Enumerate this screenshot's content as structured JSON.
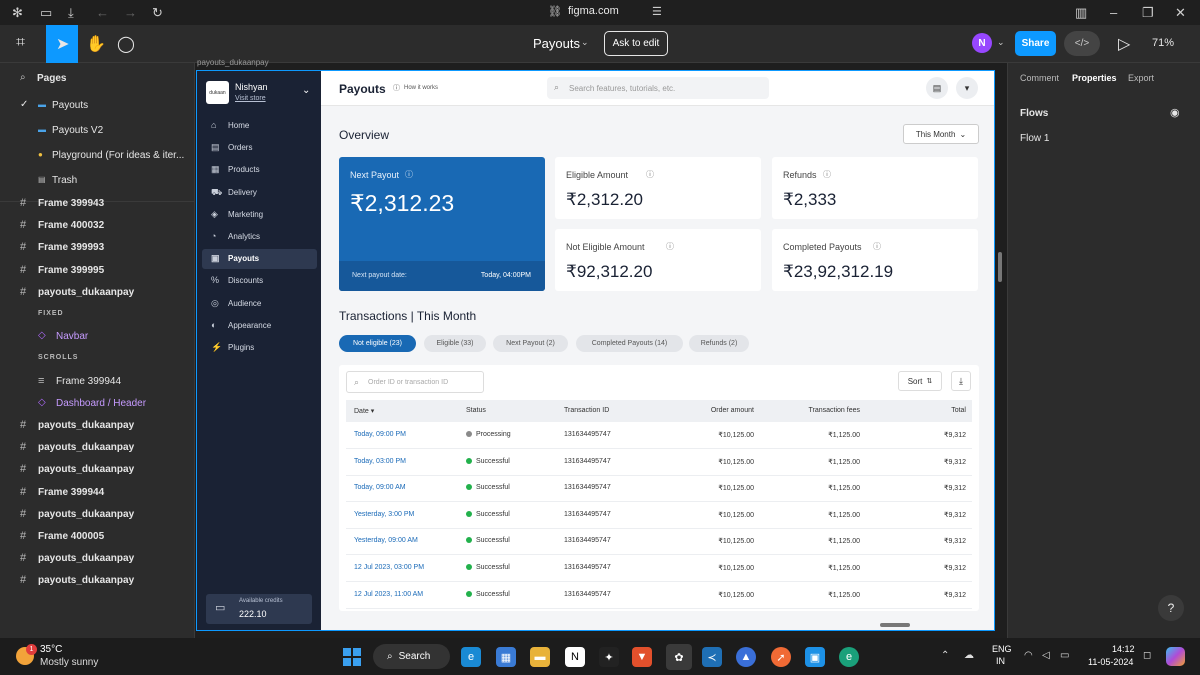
{
  "browser": {
    "url": "figma.com"
  },
  "toolbar": {
    "file_title": "Payouts",
    "ask_label": "Ask to edit",
    "avatar": "N",
    "share_label": "Share",
    "zoom": "71%"
  },
  "layers": {
    "pages_label": "Pages",
    "pages": [
      "Payouts",
      "Payouts V2",
      "Playground (For ideas & iter...",
      "Trash"
    ],
    "items": [
      {
        "label": "Frame 399943",
        "bold": true
      },
      {
        "label": "Frame 400032",
        "bold": true
      },
      {
        "label": "Frame 399993",
        "bold": true
      },
      {
        "label": "Frame 399995",
        "bold": true
      },
      {
        "label": "payouts_dukaanpay",
        "bold": true
      },
      {
        "label": "FIXED",
        "section": true
      },
      {
        "label": "Navbar",
        "purple": true
      },
      {
        "label": "SCROLLS",
        "section": true
      },
      {
        "label": "Frame 399944",
        "bold": false
      },
      {
        "label": "Dashboard / Header",
        "purple": true
      },
      {
        "label": "payouts_dukaanpay",
        "bold": true
      },
      {
        "label": "payouts_dukaanpay",
        "bold": true
      },
      {
        "label": "payouts_dukaanpay",
        "bold": true
      },
      {
        "label": "Frame 399944",
        "bold": true
      },
      {
        "label": "payouts_dukaanpay",
        "bold": true
      },
      {
        "label": "Frame 400005",
        "bold": true
      },
      {
        "label": "payouts_dukaanpay",
        "bold": true
      },
      {
        "label": "payouts_dukaanpay",
        "bold": true
      }
    ]
  },
  "canvas": {
    "frame_label": "payouts_dukaanpay"
  },
  "app": {
    "store_logo": "dukaan",
    "store_name": "Nishyan",
    "visit_store": "Visit store",
    "nav": [
      {
        "label": "Home",
        "icon": "⌂"
      },
      {
        "label": "Orders",
        "icon": "▤"
      },
      {
        "label": "Products",
        "icon": "▦"
      },
      {
        "label": "Delivery",
        "icon": "⛟"
      },
      {
        "label": "Marketing",
        "icon": "◈"
      },
      {
        "label": "Analytics",
        "icon": "◔"
      },
      {
        "label": "Payouts",
        "icon": "▣",
        "active": true
      },
      {
        "label": "Discounts",
        "icon": "%"
      },
      {
        "label": "Audience",
        "icon": "◎"
      },
      {
        "label": "Appearance",
        "icon": "◐"
      },
      {
        "label": "Plugins",
        "icon": "⚡"
      }
    ],
    "credits_label": "Available credits",
    "credits_value": "222.10",
    "page_title": "Payouts",
    "how_it_works": "How it works",
    "search_placeholder": "Search features, tutorials, etc.",
    "overview_title": "Overview",
    "period": "This Month",
    "next_payout": {
      "label": "Next Payout",
      "value": "₹2,312.23",
      "date_label": "Next payout date:",
      "date_value": "Today, 04:00PM"
    },
    "cards": [
      {
        "label": "Eligible Amount",
        "value": "₹2,312.20"
      },
      {
        "label": "Refunds",
        "value": "₹2,333"
      },
      {
        "label": "Not Eligible Amount",
        "value": "₹92,312.20"
      },
      {
        "label": "Completed Payouts",
        "value": "₹23,92,312.19"
      }
    ],
    "tx_title": "Transactions | This Month",
    "chips": [
      "Not eligible (23)",
      "Eligible (33)",
      "Next Payout (2)",
      "Completed Payouts (14)",
      "Refunds (2)"
    ],
    "filter_placeholder": "Order ID or transaction ID",
    "sort_label": "Sort",
    "columns": [
      "Date ▾",
      "Status",
      "Transaction ID",
      "Order amount",
      "Transaction fees",
      "Total"
    ],
    "rows": [
      {
        "date": "Today, 09:00 PM",
        "status": "Processing",
        "tid": "131634495747",
        "amount": "₹10,125.00",
        "fees": "₹1,125.00",
        "total": "₹9,312"
      },
      {
        "date": "Today, 03:00 PM",
        "status": "Successful",
        "tid": "131634495747",
        "amount": "₹10,125.00",
        "fees": "₹1,125.00",
        "total": "₹9,312"
      },
      {
        "date": "Today, 09:00 AM",
        "status": "Successful",
        "tid": "131634495747",
        "amount": "₹10,125.00",
        "fees": "₹1,125.00",
        "total": "₹9,312"
      },
      {
        "date": "Yesterday, 3:00 PM",
        "status": "Successful",
        "tid": "131634495747",
        "amount": "₹10,125.00",
        "fees": "₹1,125.00",
        "total": "₹9,312"
      },
      {
        "date": "Yesterday, 09:00 AM",
        "status": "Successful",
        "tid": "131634495747",
        "amount": "₹10,125.00",
        "fees": "₹1,125.00",
        "total": "₹9,312"
      },
      {
        "date": "12 Jul 2023, 03:00 PM",
        "status": "Successful",
        "tid": "131634495747",
        "amount": "₹10,125.00",
        "fees": "₹1,125.00",
        "total": "₹9,312"
      },
      {
        "date": "12 Jul 2023, 11:00 AM",
        "status": "Successful",
        "tid": "131634495747",
        "amount": "₹10,125.00",
        "fees": "₹1,125.00",
        "total": "₹9,312"
      }
    ]
  },
  "right_panel": {
    "tabs": [
      "Comment",
      "Properties",
      "Export"
    ],
    "section": "Flows",
    "flow": "Flow 1"
  },
  "taskbar": {
    "temp": "35°C",
    "weather": "Mostly sunny",
    "search": "Search",
    "lang1": "ENG",
    "lang2": "IN",
    "time": "14:12",
    "date": "11-05-2024",
    "badge": "1"
  },
  "colors": {
    "figma_blue": "#0d99ff",
    "sidebar": "#1a2234",
    "payout_blue": "#1969b4",
    "success": "#22b14c",
    "processing": "#8a8a8a"
  }
}
